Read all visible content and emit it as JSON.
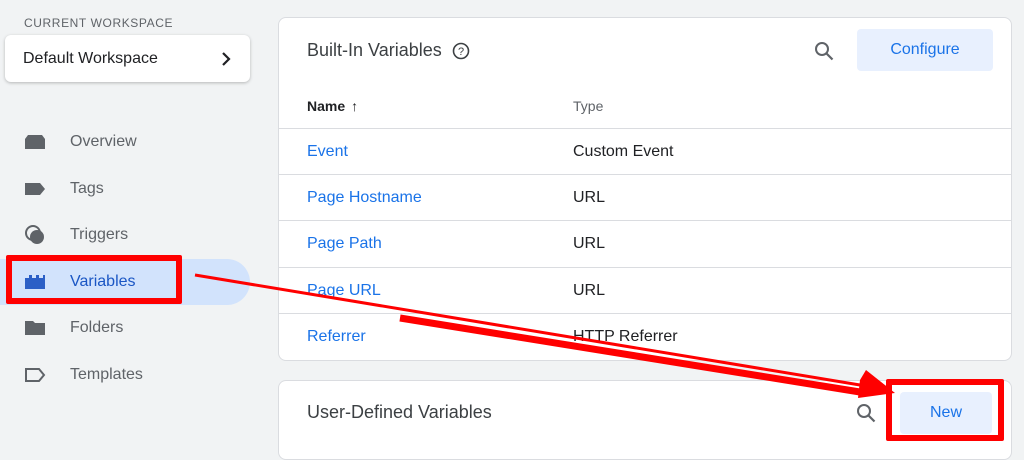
{
  "sidebar": {
    "workspace_label": "CURRENT WORKSPACE",
    "workspace_name": "Default Workspace",
    "items": [
      {
        "label": "Overview",
        "icon": "overview-icon"
      },
      {
        "label": "Tags",
        "icon": "tag-icon"
      },
      {
        "label": "Triggers",
        "icon": "trigger-icon"
      },
      {
        "label": "Variables",
        "icon": "variables-icon",
        "active": true
      },
      {
        "label": "Folders",
        "icon": "folder-icon"
      },
      {
        "label": "Templates",
        "icon": "template-icon"
      }
    ]
  },
  "builtin": {
    "title": "Built-In Variables",
    "configure_label": "Configure",
    "columns": [
      "Name",
      "Type"
    ],
    "rows": [
      {
        "name": "Event",
        "type": "Custom Event"
      },
      {
        "name": "Page Hostname",
        "type": "URL"
      },
      {
        "name": "Page Path",
        "type": "URL"
      },
      {
        "name": "Page URL",
        "type": "URL"
      },
      {
        "name": "Referrer",
        "type": "HTTP Referrer"
      }
    ]
  },
  "userdefined": {
    "title": "User-Defined Variables",
    "new_label": "New"
  },
  "colors": {
    "accent": "#1a73e8",
    "annotation": "#ff0000",
    "active_bg": "#d2e3fc"
  }
}
